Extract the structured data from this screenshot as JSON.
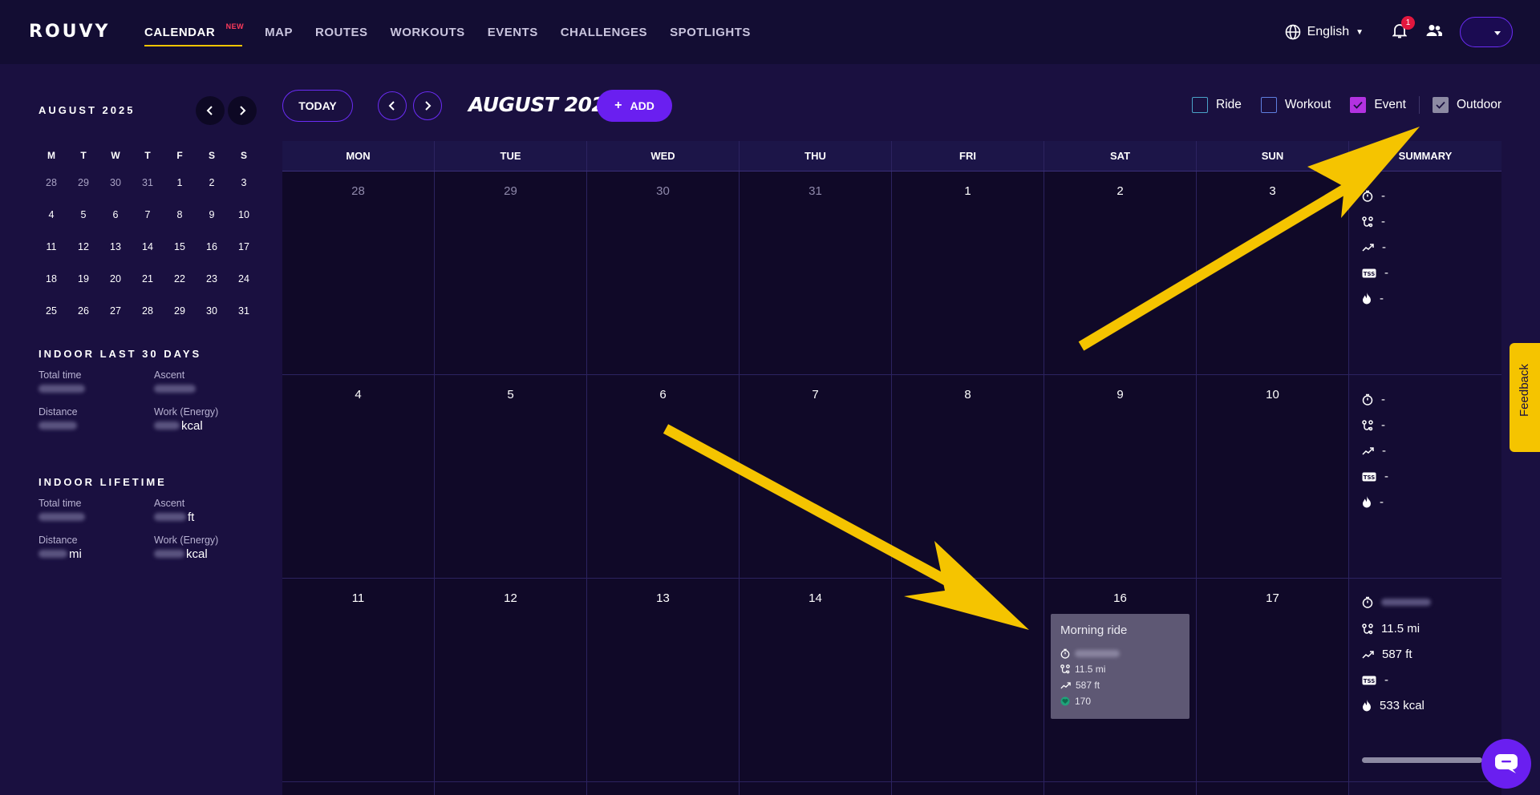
{
  "brand": "ROUVY",
  "nav": {
    "items": [
      {
        "label": "CALENDAR",
        "badge": "NEW",
        "active": true
      },
      {
        "label": "MAP"
      },
      {
        "label": "ROUTES"
      },
      {
        "label": "WORKOUTS"
      },
      {
        "label": "EVENTS"
      },
      {
        "label": "CHALLENGES"
      },
      {
        "label": "SPOTLIGHTS"
      }
    ],
    "language": "English",
    "notification_count": "1"
  },
  "mini_calendar": {
    "title": "AUGUST 2025",
    "weekdays": [
      "M",
      "T",
      "W",
      "T",
      "F",
      "S",
      "S"
    ],
    "weeks": [
      [
        [
          "28",
          true
        ],
        [
          "29",
          true
        ],
        [
          "30",
          true
        ],
        [
          "31",
          true
        ],
        [
          "1",
          false
        ],
        [
          "2",
          false
        ],
        [
          "3",
          false
        ]
      ],
      [
        [
          "4",
          false
        ],
        [
          "5",
          false
        ],
        [
          "6",
          false
        ],
        [
          "7",
          false
        ],
        [
          "8",
          false
        ],
        [
          "9",
          false
        ],
        [
          "10",
          false
        ]
      ],
      [
        [
          "11",
          false
        ],
        [
          "12",
          false
        ],
        [
          "13",
          false
        ],
        [
          "14",
          false
        ],
        [
          "15",
          false
        ],
        [
          "16",
          false
        ],
        [
          "17",
          false
        ]
      ],
      [
        [
          "18",
          false
        ],
        [
          "19",
          false
        ],
        [
          "20",
          false
        ],
        [
          "21",
          false
        ],
        [
          "22",
          false
        ],
        [
          "23",
          false
        ],
        [
          "24",
          false
        ]
      ],
      [
        [
          "25",
          false
        ],
        [
          "26",
          false
        ],
        [
          "27",
          false
        ],
        [
          "28",
          false
        ],
        [
          "29",
          false
        ],
        [
          "30",
          false
        ],
        [
          "31",
          false
        ]
      ]
    ]
  },
  "indoor_30": {
    "heading": "INDOOR LAST 30 DAYS",
    "total_time_label": "Total time",
    "ascent_label": "Ascent",
    "distance_label": "Distance",
    "energy_label": "Work (Energy)",
    "energy_unit": "kcal"
  },
  "indoor_lifetime": {
    "heading": "INDOOR LIFETIME",
    "total_time_label": "Total time",
    "ascent_label": "Ascent",
    "ascent_unit": "ft",
    "distance_label": "Distance",
    "distance_unit": "mi",
    "energy_label": "Work (Energy)",
    "energy_unit": "kcal"
  },
  "toolbar": {
    "today": "TODAY",
    "month_title": "AUGUST 2025",
    "add": "ADD",
    "filters": [
      {
        "label": "Ride",
        "checked": false
      },
      {
        "label": "Workout",
        "checked": false
      },
      {
        "label": "Event",
        "checked": true
      },
      {
        "label": "Outdoor",
        "checked": true
      }
    ]
  },
  "calendar": {
    "headers": [
      "MON",
      "TUE",
      "WED",
      "THU",
      "FRI",
      "SAT",
      "SUN",
      "SUMMARY"
    ],
    "weeks": [
      {
        "days": [
          [
            "28",
            true
          ],
          [
            "29",
            true
          ],
          [
            "30",
            true
          ],
          [
            "31",
            true
          ],
          [
            "1",
            false
          ],
          [
            "2",
            false
          ],
          [
            "3",
            false
          ]
        ],
        "summary": {
          "time": "-",
          "distance": "-",
          "elevation": "-",
          "tss": "-",
          "energy": "-"
        }
      },
      {
        "days": [
          [
            "4",
            false
          ],
          [
            "5",
            false
          ],
          [
            "6",
            false
          ],
          [
            "7",
            false
          ],
          [
            "8",
            false
          ],
          [
            "9",
            false
          ],
          [
            "10",
            false
          ]
        ],
        "summary": {
          "time": "-",
          "distance": "-",
          "elevation": "-",
          "tss": "-",
          "energy": "-"
        }
      },
      {
        "days": [
          [
            "11",
            false
          ],
          [
            "12",
            false
          ],
          [
            "13",
            false
          ],
          [
            "14",
            false
          ],
          [
            "15",
            false
          ],
          [
            "16",
            false
          ],
          [
            "17",
            false
          ]
        ],
        "summary": {
          "time": "",
          "distance": "11.5 mi",
          "elevation": "587 ft",
          "tss": "-",
          "energy": "533 kcal"
        }
      }
    ],
    "activity": {
      "title": "Morning ride",
      "distance": "11.5 mi",
      "elevation": "587 ft",
      "heart_rate": "170"
    }
  },
  "feedback_label": "Feedback",
  "colors": {
    "accent": "#6a1ff0",
    "highlight": "#f5c400",
    "background": "#1a1040",
    "nav_background": "#130d33"
  }
}
